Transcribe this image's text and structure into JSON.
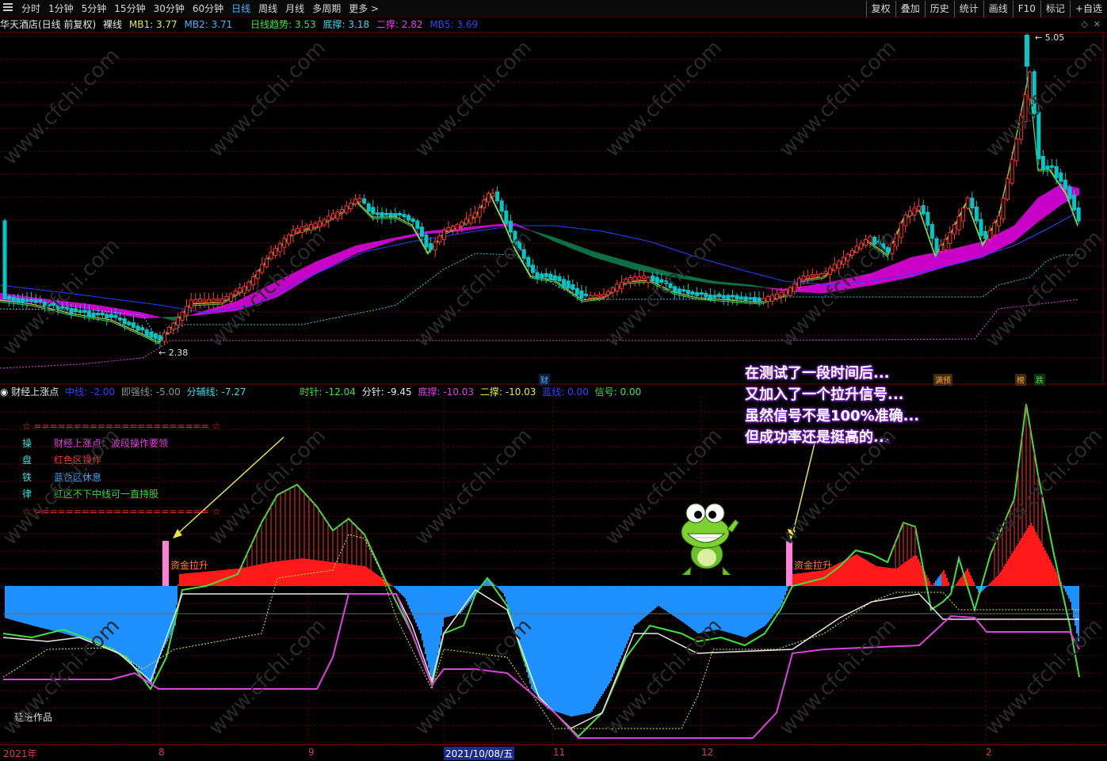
{
  "toolbar": {
    "periods": [
      "分时",
      "1分钟",
      "5分钟",
      "15分钟",
      "30分钟",
      "60分钟",
      "日线",
      "周线",
      "月线",
      "多周期",
      "更多 >"
    ],
    "active_period": "日线",
    "tools": [
      "复权",
      "叠加",
      "历史",
      "统计",
      "画线",
      "F10",
      "标记",
      "+自选"
    ]
  },
  "main_info": {
    "stock": "华天酒店(日线 前复权)",
    "indicator": "裸线",
    "mb1": "MB1: 3.77",
    "mb2": "MB2: 3.71",
    "trend": "日线趋势: 3.53",
    "dicheng": "底撑: 3.18",
    "ercheng": "二撑: 2.82",
    "mb5": "MB5: 3.69"
  },
  "main_chart": {
    "high_label": "5.05",
    "low_label": "2.38"
  },
  "event_tags": [
    "财",
    "满预",
    "榜",
    "跌"
  ],
  "sub_info": {
    "name": "财经上涨点",
    "zhongxian": "中线: -2.00",
    "jiqiang": "即强线: -5.00",
    "fenfu": "分辅线: -7.27",
    "shizhen": "时针: -12.04",
    "fenzhen": "分针: -9.45",
    "dicheng": "底撑: -10.03",
    "ercheng": "二撑: -10.03",
    "lanxian": "蓝线: 0.00",
    "xinhao": "信号: 0.00"
  },
  "legend": {
    "top": "☆ ====================== ☆",
    "rows": [
      {
        "k": "操",
        "v": "财经上涨点：波段操作要领",
        "color": "#e040e0"
      },
      {
        "k": "盘",
        "v": "红色区操作",
        "color": "#ff3030"
      },
      {
        "k": "铁",
        "v": "蓝色区休息",
        "color": "#3aa8ff"
      },
      {
        "k": "律",
        "v": "红区不下中线可一直持股",
        "color": "#40d040"
      }
    ],
    "bottom": "☆ ====================== ☆"
  },
  "signal_label": "资金拉升",
  "annotation": [
    "在测试了一段时间后...",
    "又加入了一个拉升信号...",
    "虽然信号不是100%准确...",
    "但成功率还是挺高的..."
  ],
  "author": "廷进作品",
  "dates": {
    "start": "2021年",
    "m8": "8",
    "m9": "9",
    "cursor": "2021/10/08/五",
    "m11": "11",
    "m12": "12",
    "m2": "2"
  },
  "watermark": "www.cfchi.com",
  "colors": {
    "up": "#ff3030",
    "down": "#00c8c8",
    "magenta": "#c800c8",
    "green_band": "#0f6e46",
    "blue_fill": "#1e90ff",
    "red_fill": "#ff1a1a"
  }
}
